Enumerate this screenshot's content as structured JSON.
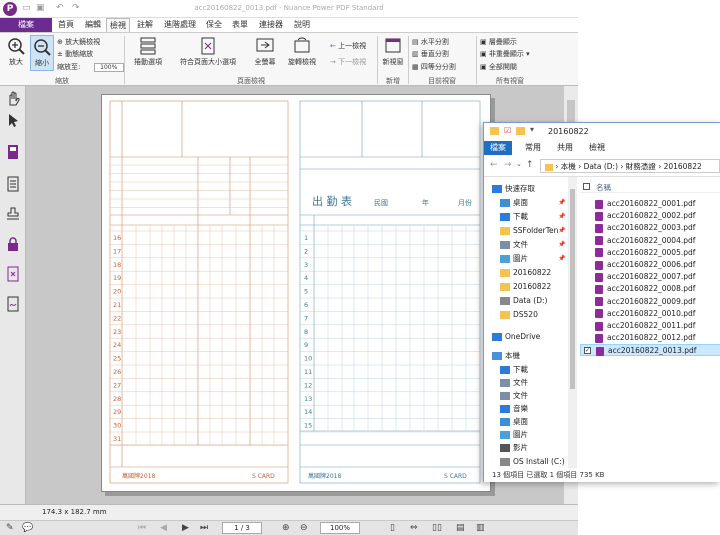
{
  "app": {
    "title": "acc20160822_0013.pdf - Nuance Power PDF Standard",
    "logo": "P",
    "tabs": [
      "檔案",
      "首頁",
      "編輯",
      "檢視",
      "註解",
      "進階處理",
      "保全",
      "表單",
      "連接器",
      "說明"
    ],
    "active_tab": "檢視",
    "ribbon": {
      "zoom_in": "放大",
      "zoom_out": "縮小",
      "zoom_magnifier": "放大鏡檢視",
      "dynamic_zoom": "動態縮放",
      "zoom_to_label": "縮放至:",
      "zoom_to_value": "100%",
      "group_zoom": "縮放",
      "scroll_options": "捲動選項",
      "fit_page_size": "符合頁面大小選項",
      "full_screen": "全螢幕",
      "rotate_view": "旋轉檢視",
      "prev_view": "上一檢視",
      "next_view": "下一檢視",
      "group_page_view": "頁面檢視",
      "new_window": "新視窗",
      "group_new": "新增",
      "split_horizontal": "水平分割",
      "split_vertical": "垂直分割",
      "split_quad": "四等分分割",
      "group_current_window": "目前視窗",
      "cascade": "層疊顯示",
      "tile": "非重疊顯示",
      "show_all": "全部開關",
      "group_all_windows": "所有視窗"
    },
    "status": {
      "page_size": "174.3 x 182.7 mm"
    },
    "nav": {
      "page": "1 / 3",
      "zoom": "100%"
    }
  },
  "form": {
    "card_left": {
      "footer_left": "萬國牌2018",
      "footer_right": "S CARD",
      "days": [
        "16",
        "17",
        "18",
        "19",
        "20",
        "21",
        "22",
        "23",
        "24",
        "25",
        "26",
        "27",
        "28",
        "29",
        "30",
        "31"
      ]
    },
    "card_right": {
      "title": "出 勤 表",
      "era": "民國",
      "year_label": "年",
      "month_label": "月份",
      "footer_left": "萬國牌2018",
      "footer_right": "S CARD",
      "days": [
        "1",
        "2",
        "3",
        "4",
        "5",
        "6",
        "7",
        "8",
        "9",
        "10",
        "11",
        "12",
        "13",
        "14",
        "15"
      ]
    }
  },
  "explorer": {
    "title": "20160822",
    "tabs": [
      "檔案",
      "常用",
      "共用",
      "檢視"
    ],
    "address": [
      "本機",
      "Data (D:)",
      "財務憑證",
      "20160822"
    ],
    "nav_items": [
      {
        "label": "快速存取",
        "icon": "star-icon"
      },
      {
        "label": "桌面",
        "icon": "desktop-icon",
        "pinned": true
      },
      {
        "label": "下載",
        "icon": "download-icon",
        "pinned": true
      },
      {
        "label": "SSFolderTen",
        "icon": "folder-icon",
        "pinned": true
      },
      {
        "label": "文件",
        "icon": "documents-icon",
        "pinned": true
      },
      {
        "label": "圖片",
        "icon": "pictures-icon",
        "pinned": true
      },
      {
        "label": "20160822",
        "icon": "folder-icon"
      },
      {
        "label": "20160822",
        "icon": "folder-icon"
      },
      {
        "label": "Data (D:)",
        "icon": "drive-icon"
      },
      {
        "label": "DS520",
        "icon": "folder-icon"
      },
      {
        "label": "OneDrive",
        "icon": "cloud-icon"
      },
      {
        "label": "本機",
        "icon": "computer-icon"
      },
      {
        "label": "下載",
        "icon": "download-icon"
      },
      {
        "label": "文件",
        "icon": "documents-icon"
      },
      {
        "label": "文件",
        "icon": "documents-icon"
      },
      {
        "label": "音樂",
        "icon": "music-icon"
      },
      {
        "label": "桌面",
        "icon": "desktop-icon"
      },
      {
        "label": "圖片",
        "icon": "pictures-icon"
      },
      {
        "label": "影片",
        "icon": "video-icon"
      },
      {
        "label": "OS Install (C:)",
        "icon": "drive-icon"
      }
    ],
    "column_name": "名稱",
    "files": [
      "acc20160822_0001.pdf",
      "acc20160822_0002.pdf",
      "acc20160822_0003.pdf",
      "acc20160822_0004.pdf",
      "acc20160822_0005.pdf",
      "acc20160822_0006.pdf",
      "acc20160822_0007.pdf",
      "acc20160822_0008.pdf",
      "acc20160822_0009.pdf",
      "acc20160822_0010.pdf",
      "acc20160822_0011.pdf",
      "acc20160822_0012.pdf",
      "acc20160822_0013.pdf"
    ],
    "selected_file": "acc20160822_0013.pdf",
    "status": "13 個項目    已選取 1 個項目  735 KB"
  }
}
